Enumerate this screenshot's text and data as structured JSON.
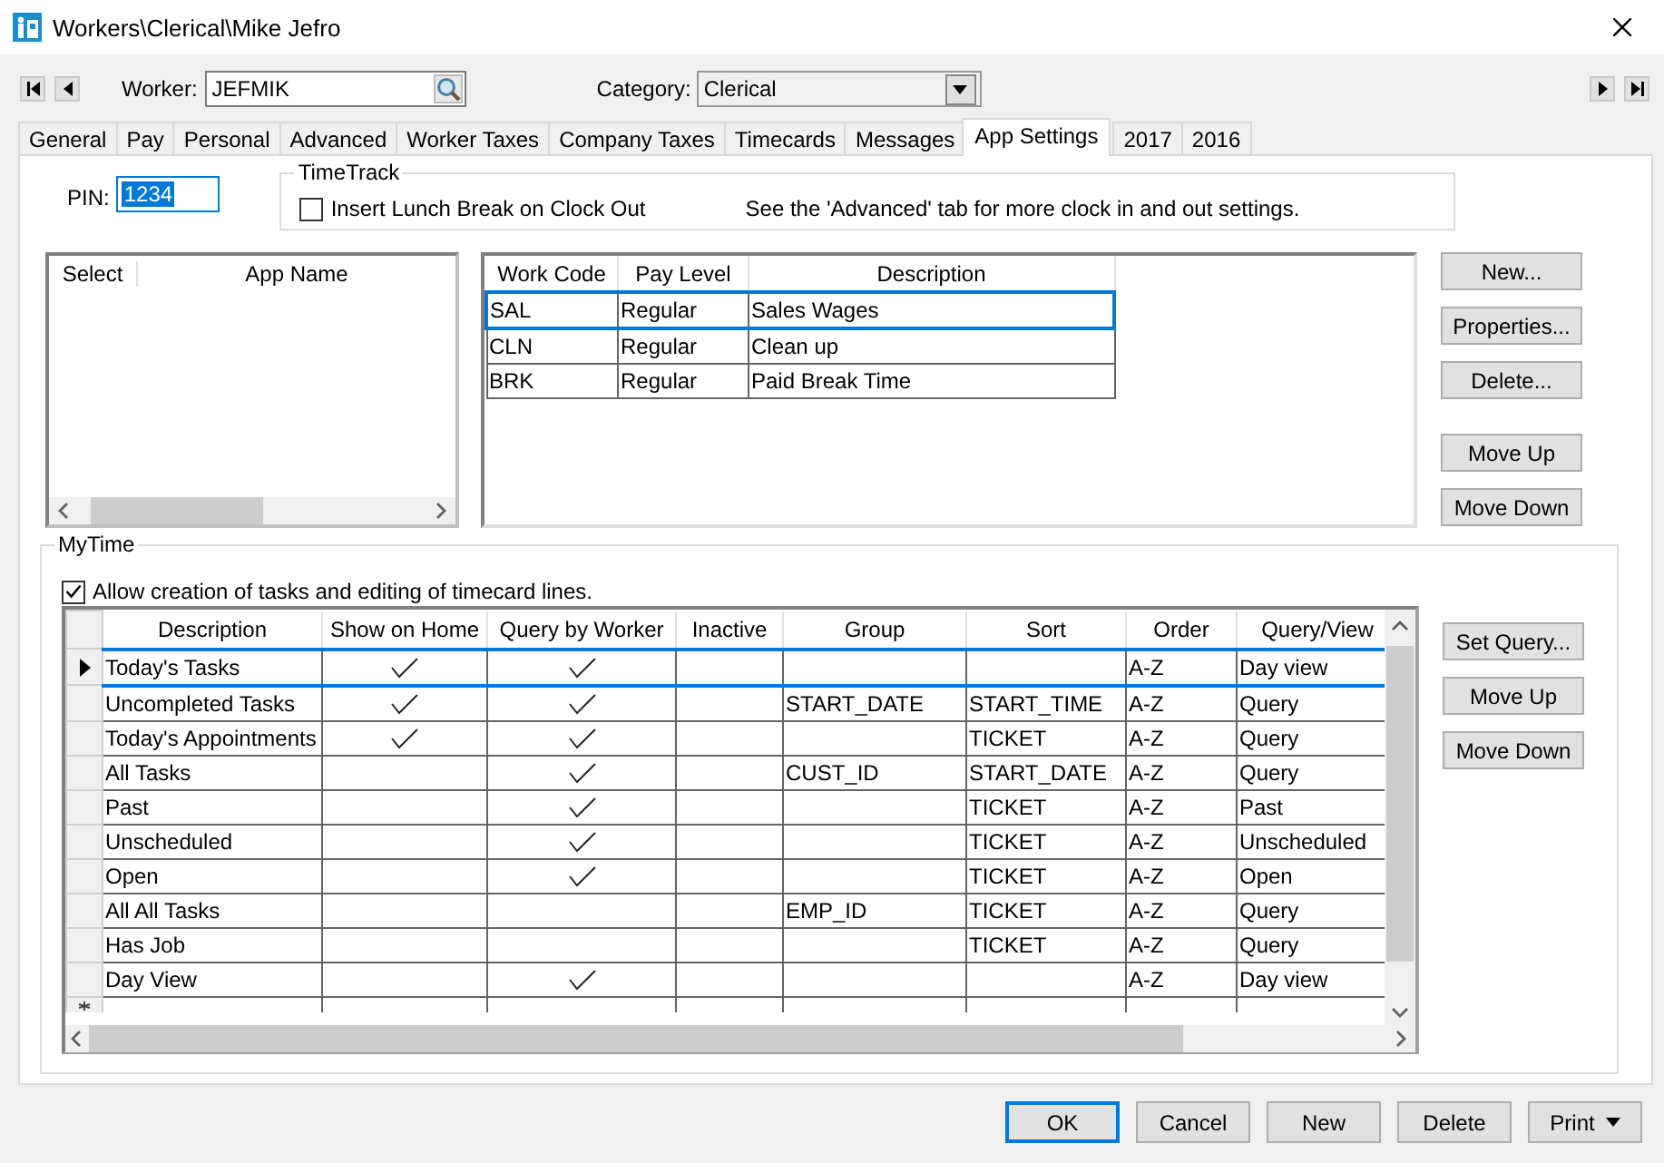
{
  "window": {
    "title": "Workers\\Clerical\\Mike Jefro"
  },
  "worker": {
    "label": "Worker:",
    "value": "JEFMIK"
  },
  "category": {
    "label": "Category:",
    "value": "Clerical"
  },
  "tabs": [
    {
      "label": "General",
      "selected": false
    },
    {
      "label": "Pay",
      "selected": false
    },
    {
      "label": "Personal",
      "selected": false
    },
    {
      "label": "Advanced",
      "selected": false
    },
    {
      "label": "Worker Taxes",
      "selected": false
    },
    {
      "label": "Company Taxes",
      "selected": false
    },
    {
      "label": "Timecards",
      "selected": false
    },
    {
      "label": "Messages",
      "selected": false
    },
    {
      "label": "App Settings",
      "selected": true
    },
    {
      "label": "2017",
      "selected": false
    },
    {
      "label": "2016",
      "selected": false
    }
  ],
  "pin": {
    "label": "PIN:",
    "value": "1234"
  },
  "timetrack": {
    "title": "TimeTrack",
    "option": {
      "label": "Insert Lunch Break on Clock Out",
      "checked": false
    },
    "note": "See the 'Advanced' tab for more clock in and out settings."
  },
  "app_list": {
    "columns": [
      "Select",
      "App Name"
    ]
  },
  "work_codes": {
    "columns": [
      "Work Code",
      "Pay Level",
      "Description"
    ],
    "rows": [
      {
        "cells": [
          "SAL",
          "Regular",
          "Sales Wages"
        ],
        "selected": true
      },
      {
        "cells": [
          "CLN",
          "Regular",
          "Clean up"
        ],
        "selected": false
      },
      {
        "cells": [
          "BRK",
          "Regular",
          "Paid Break Time"
        ],
        "selected": false
      }
    ]
  },
  "work_code_buttons": [
    [
      "New...",
      "Properties...",
      "Delete..."
    ],
    [
      "Move Up",
      "Move Down"
    ]
  ],
  "mytime": {
    "title": "MyTime",
    "option": {
      "label": "Allow creation of tasks and editing of timecard lines.",
      "checked": true
    },
    "columns": [
      "Description",
      "Show on Home",
      "Query by Worker",
      "Inactive",
      "Group",
      "Sort",
      "Order",
      "Query/View"
    ],
    "rows": [
      {
        "description": "Today's Tasks",
        "show_on_home": true,
        "query_by_worker": true,
        "inactive": false,
        "order": "A-Z",
        "view": "Day view",
        "selected": true
      },
      {
        "description": "Uncompleted Tasks",
        "show_on_home": true,
        "query_by_worker": true,
        "inactive": false,
        "group": "START_DATE",
        "sort": "START_TIME",
        "order": "A-Z",
        "view": "Query",
        "selected": false
      },
      {
        "description": "Today's Appointments",
        "show_on_home": true,
        "query_by_worker": true,
        "inactive": false,
        "sort": "TICKET",
        "order": "A-Z",
        "view": "Query",
        "selected": false
      },
      {
        "description": "All Tasks",
        "show_on_home": false,
        "query_by_worker": true,
        "inactive": false,
        "group": "CUST_ID",
        "sort": "START_DATE",
        "order": "A-Z",
        "view": "Query",
        "selected": false
      },
      {
        "description": "Past",
        "show_on_home": false,
        "query_by_worker": true,
        "inactive": false,
        "sort": "TICKET",
        "order": "A-Z",
        "view": "Past",
        "selected": false
      },
      {
        "description": "Unscheduled",
        "show_on_home": false,
        "query_by_worker": true,
        "inactive": false,
        "sort": "TICKET",
        "order": "A-Z",
        "view": "Unscheduled",
        "selected": false
      },
      {
        "description": "Open",
        "show_on_home": false,
        "query_by_worker": true,
        "inactive": false,
        "sort": "TICKET",
        "order": "A-Z",
        "view": "Open",
        "selected": false
      },
      {
        "description": "All All Tasks",
        "show_on_home": false,
        "query_by_worker": false,
        "inactive": false,
        "group": "EMP_ID",
        "sort": "TICKET",
        "order": "A-Z",
        "view": "Query",
        "selected": false
      },
      {
        "description": "Has Job",
        "show_on_home": false,
        "query_by_worker": false,
        "inactive": false,
        "sort": "TICKET",
        "order": "A-Z",
        "view": "Query",
        "selected": false
      },
      {
        "description": "Day View",
        "show_on_home": false,
        "query_by_worker": true,
        "inactive": false,
        "order": "A-Z",
        "view": "Day view",
        "selected": false
      }
    ],
    "buttons": [
      "Set Query...",
      "Move Up",
      "Move Down"
    ]
  },
  "dialog_buttons": [
    {
      "label": "OK",
      "default": true,
      "kind": "plain"
    },
    {
      "label": "Cancel",
      "default": false,
      "kind": "plain"
    },
    {
      "label": "New",
      "default": false,
      "kind": "plain"
    },
    {
      "label": "Delete",
      "default": false,
      "kind": "plain"
    },
    {
      "label": "Print",
      "default": false,
      "kind": "menu"
    }
  ]
}
